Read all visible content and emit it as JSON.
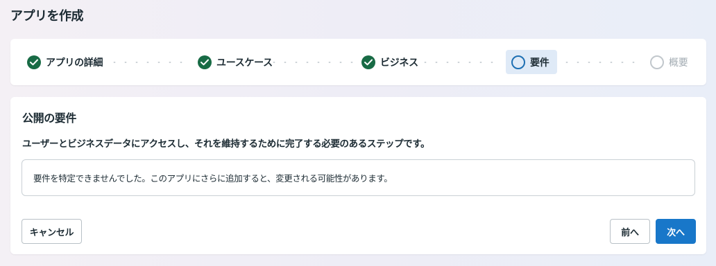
{
  "page": {
    "title": "アプリを作成"
  },
  "stepper": {
    "steps": [
      {
        "label": "アプリの詳細",
        "status": "completed",
        "icon": "check-icon"
      },
      {
        "label": "ユースケース",
        "status": "completed",
        "icon": "check-icon"
      },
      {
        "label": "ビジネス",
        "status": "completed",
        "icon": "check-icon"
      },
      {
        "label": "要件",
        "status": "current",
        "icon": "ring-icon"
      },
      {
        "label": "概要",
        "status": "pending",
        "icon": "ring-icon"
      }
    ]
  },
  "main": {
    "title": "公開の要件",
    "description": "ユーザーとビジネスデータにアクセスし、それを維持するために完了する必要のあるステップです。",
    "notice": "要件を特定できませんでした。このアプリにさらに追加すると、変更される可能性があります。"
  },
  "buttons": {
    "cancel": "キャンセル",
    "back": "前へ",
    "next": "次へ"
  },
  "colors": {
    "completed": "#186b45",
    "current_ring": "#1d6fb3",
    "current_bg": "#dfeaf7",
    "primary_button": "#1877c9"
  }
}
